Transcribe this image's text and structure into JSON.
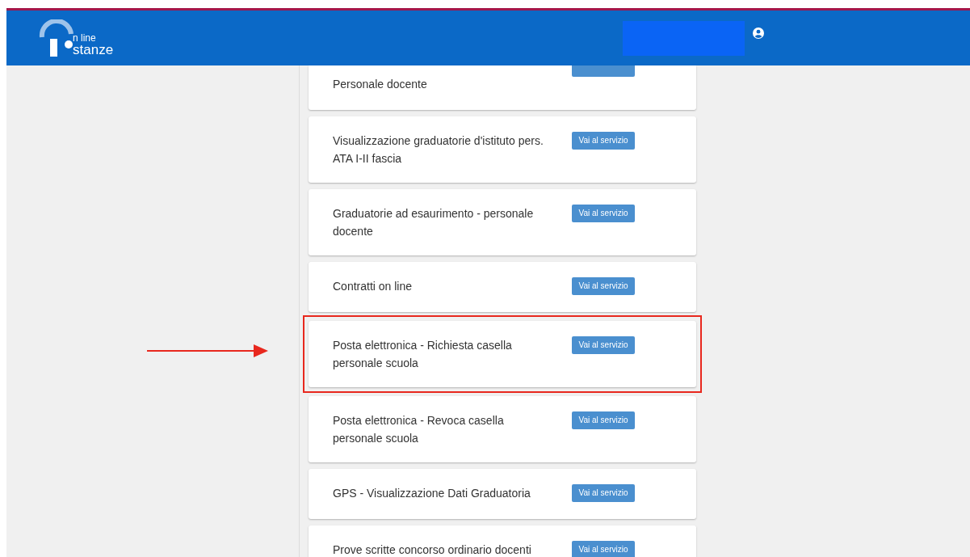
{
  "header": {
    "logo": {
      "line1": "n line",
      "line2": "stanze"
    }
  },
  "services": [
    {
      "kind": "partial",
      "title": "Personale docente",
      "highlighted": false
    },
    {
      "kind": "full",
      "title": "Visualizzazione graduatorie d'istituto pers. ATA I-II fascia",
      "button": "Vai al servizio",
      "highlighted": false
    },
    {
      "kind": "full",
      "title": "Graduatorie ad esaurimento - personale docente",
      "button": "Vai al servizio",
      "highlighted": false
    },
    {
      "kind": "full",
      "title": "Contratti on line",
      "button": "Vai al servizio",
      "highlighted": false
    },
    {
      "kind": "full",
      "title": "Posta elettronica - Richiesta casella personale scuola",
      "button": "Vai al servizio",
      "highlighted": true
    },
    {
      "kind": "full",
      "title": "Posta elettronica - Revoca casella personale scuola",
      "button": "Vai al servizio",
      "highlighted": false
    },
    {
      "kind": "full",
      "title": "GPS - Visualizzazione Dati Graduatoria",
      "button": "Vai al servizio",
      "highlighted": false
    },
    {
      "kind": "full",
      "title": "Prove scritte concorso ordinario docenti",
      "button": "Vai al servizio",
      "highlighted": false
    }
  ]
}
